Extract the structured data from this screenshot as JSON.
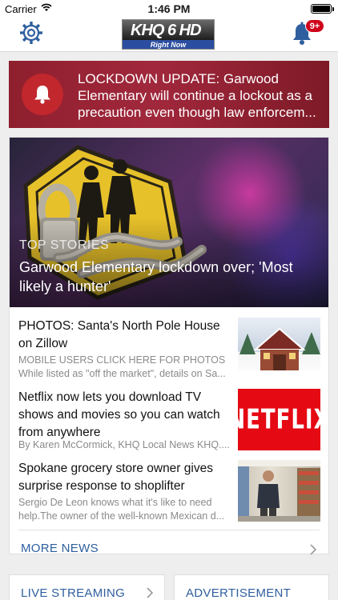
{
  "status_bar": {
    "carrier": "Carrier",
    "time": "1:46 PM",
    "battery_percent": 100
  },
  "nav": {
    "settings_icon": "gear-icon",
    "logo_text": "KHQ 6 HD",
    "logo_subtitle": "Right Now",
    "notifications_icon": "bell-icon",
    "notification_badge": "9+"
  },
  "alert": {
    "icon": "bell-icon",
    "text": "LOCKDOWN UPDATE: Garwood Elementary will continue a lockout as a precaution even though law enforcem..."
  },
  "top_story": {
    "category": "TOP STORIES",
    "title": "Garwood Elementary lockdown over; 'Most likely a hunter'"
  },
  "stories": [
    {
      "title": "PHOTOS: Santa's North Pole House on Zillow",
      "subtitle_1": "MOBILE USERS CLICK HERE FOR PHOTOS",
      "subtitle_2": "While listed as \"off the market\", details on Sa..."
    },
    {
      "title": "Netflix now lets you download TV shows and movies so you can watch from anywhere",
      "subtitle_1": "By Karen McCormick, KHQ Local News KHQ...."
    },
    {
      "title": "Spokane grocery store owner gives surprise response to shoplifter",
      "subtitle_1": "Sergio De Leon knows what it's like to need",
      "subtitle_2": "help.The owner of the well-known Mexican d..."
    }
  ],
  "netflix_thumb_text": "NETFLIX",
  "more_news": "MORE NEWS",
  "tiles": {
    "live_streaming": "LIVE STREAMING",
    "advertisement": "ADVERTISEMENT"
  },
  "colors": {
    "accent_blue": "#2f5f9e",
    "alert_red": "#8e1f2d",
    "badge_red": "#d0021b"
  }
}
